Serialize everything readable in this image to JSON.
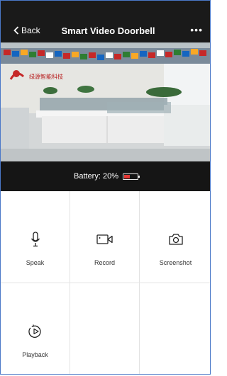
{
  "header": {
    "back_label": "Back",
    "title": "Smart  Video Doorbell",
    "more_label": "•••"
  },
  "video": {
    "wall_text": "绿源智能科技"
  },
  "status": {
    "battery_label": "Battery: 20%",
    "battery_percent": 20,
    "battery_color": "#e53935"
  },
  "actions": [
    {
      "label": "Speak",
      "icon": "microphone-icon"
    },
    {
      "label": "Record",
      "icon": "video-camera-icon"
    },
    {
      "label": "Screenshot",
      "icon": "camera-icon"
    },
    {
      "label": "Playback",
      "icon": "playback-icon"
    }
  ]
}
